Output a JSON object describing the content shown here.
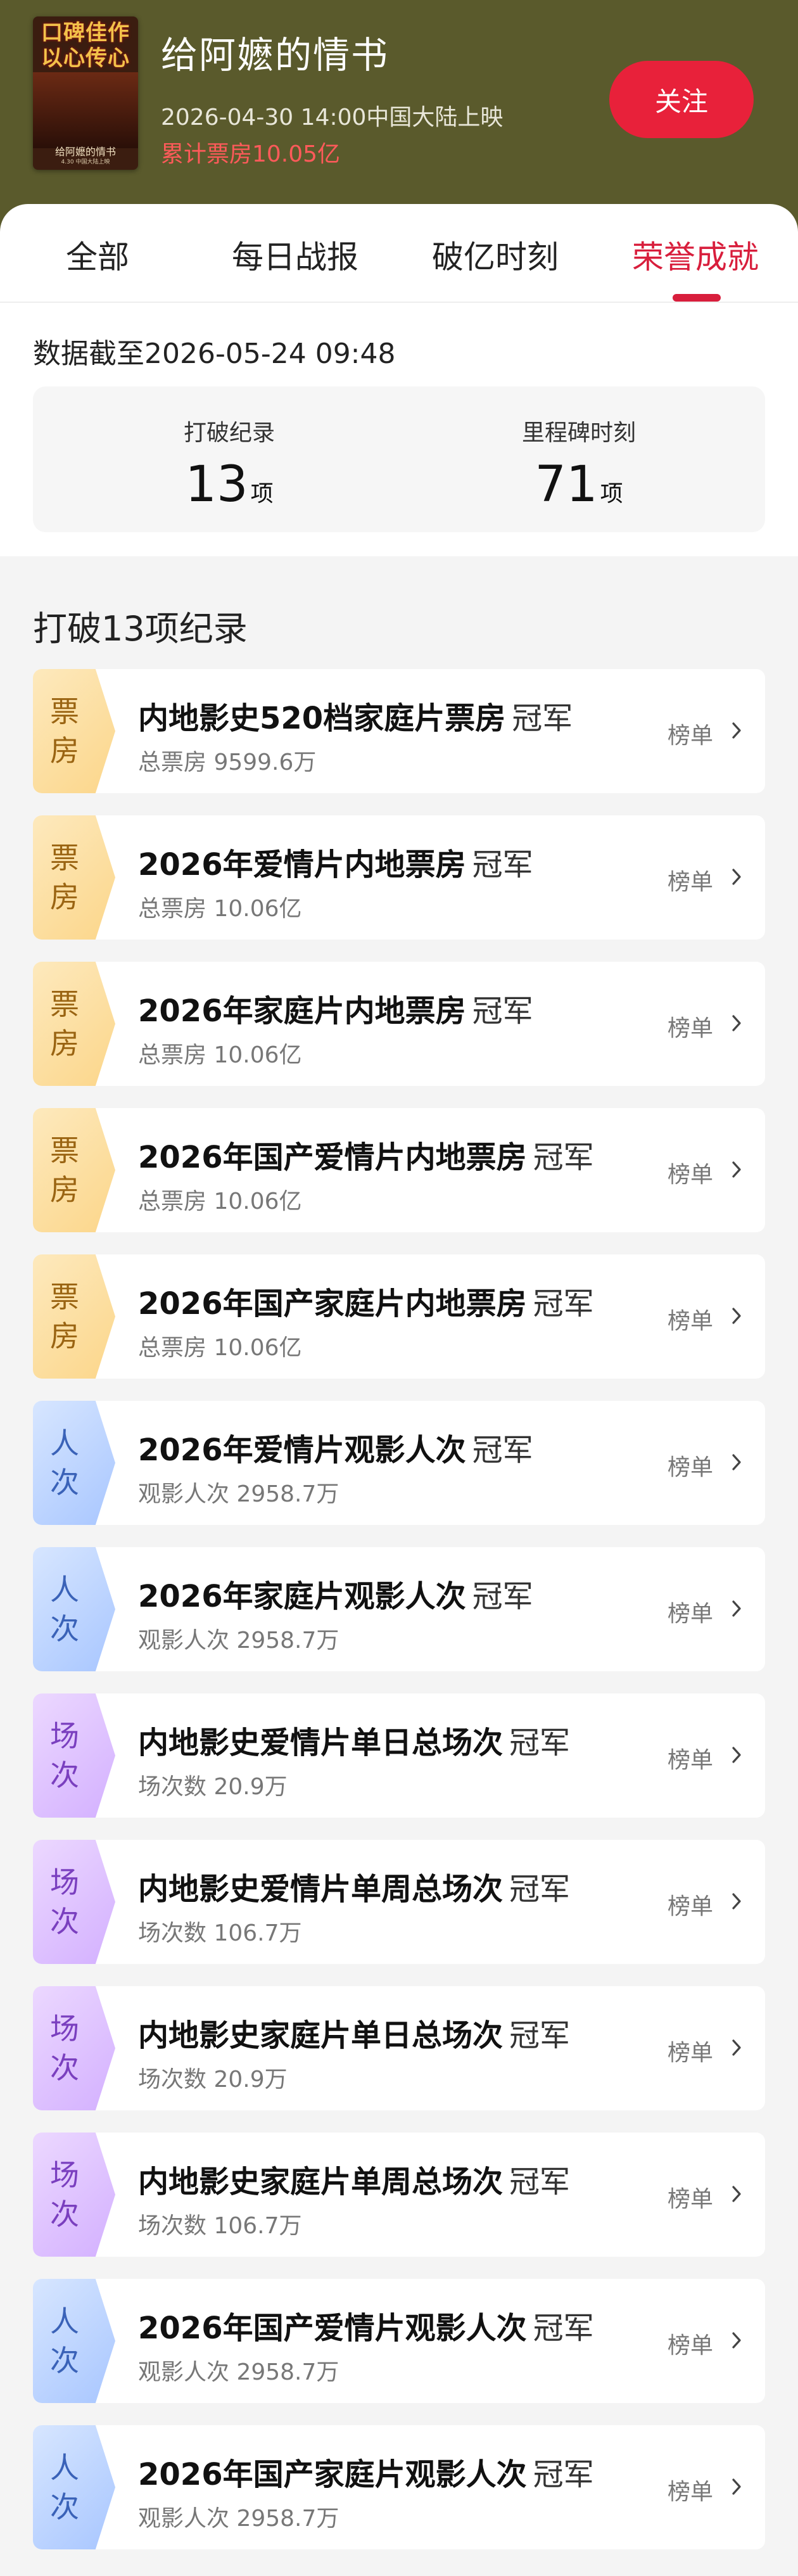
{
  "movie": {
    "poster_text": [
      "口碑佳作",
      "以心传心"
    ],
    "poster_film": "给阿嬷的情书",
    "poster_footer": "4.30 中国大陆上映",
    "title": "给阿嬷的情书",
    "release": "2026-04-30 14:00中国大陆上映",
    "box_office": "累计票房10.05亿",
    "follow_label": "关注"
  },
  "tabs": [
    {
      "label": "全部"
    },
    {
      "label": "每日战报"
    },
    {
      "label": "破亿时刻"
    },
    {
      "label": "荣誉成就"
    }
  ],
  "active_tab": "荣誉成就",
  "stats": {
    "as_of_prefix": "数据截至",
    "as_of_time": "2026-05-24  09:48",
    "records_label": "打破纪录",
    "records_value": "13",
    "records_unit": "项",
    "milestones_label": "里程碑时刻",
    "milestones_value": "71",
    "milestones_unit": "项"
  },
  "section_title": "打破13项纪录",
  "records": [
    {
      "badge": [
        "票",
        "房"
      ],
      "kind": "box",
      "title": "内地影史520档家庭片票房",
      "champ": "冠军",
      "sub": "总票房 9599.6万",
      "link": "榜单"
    },
    {
      "badge": [
        "票",
        "房"
      ],
      "kind": "box",
      "title": "2026年爱情片内地票房",
      "champ": "冠军",
      "sub": "总票房 10.06亿",
      "link": "榜单"
    },
    {
      "badge": [
        "票",
        "房"
      ],
      "kind": "box",
      "title": "2026年家庭片内地票房",
      "champ": "冠军",
      "sub": "总票房 10.06亿",
      "link": "榜单"
    },
    {
      "badge": [
        "票",
        "房"
      ],
      "kind": "box",
      "title": "2026年国产爱情片内地票房",
      "champ": "冠军",
      "sub": "总票房 10.06亿",
      "link": "榜单"
    },
    {
      "badge": [
        "票",
        "房"
      ],
      "kind": "box",
      "title": "2026年国产家庭片内地票房",
      "champ": "冠军",
      "sub": "总票房 10.06亿",
      "link": "榜单"
    },
    {
      "badge": [
        "人",
        "次"
      ],
      "kind": "people",
      "title": "2026年爱情片观影人次",
      "champ": "冠军",
      "sub": "观影人次 2958.7万",
      "link": "榜单"
    },
    {
      "badge": [
        "人",
        "次"
      ],
      "kind": "people",
      "title": "2026年家庭片观影人次",
      "champ": "冠军",
      "sub": "观影人次 2958.7万",
      "link": "榜单"
    },
    {
      "badge": [
        "场",
        "次"
      ],
      "kind": "screen",
      "title": "内地影史爱情片单日总场次",
      "champ": "冠军",
      "sub": "场次数 20.9万",
      "link": "榜单"
    },
    {
      "badge": [
        "场",
        "次"
      ],
      "kind": "screen",
      "title": "内地影史爱情片单周总场次",
      "champ": "冠军",
      "sub": "场次数 106.7万",
      "link": "榜单"
    },
    {
      "badge": [
        "场",
        "次"
      ],
      "kind": "screen",
      "title": "内地影史家庭片单日总场次",
      "champ": "冠军",
      "sub": "场次数 20.9万",
      "link": "榜单"
    },
    {
      "badge": [
        "场",
        "次"
      ],
      "kind": "screen",
      "title": "内地影史家庭片单周总场次",
      "champ": "冠军",
      "sub": "场次数 106.7万",
      "link": "榜单"
    },
    {
      "badge": [
        "人",
        "次"
      ],
      "kind": "people",
      "title": "2026年国产爱情片观影人次",
      "champ": "冠军",
      "sub": "观影人次 2958.7万",
      "link": "榜单"
    },
    {
      "badge": [
        "人",
        "次"
      ],
      "kind": "people",
      "title": "2026年国产家庭片观影人次",
      "champ": "冠军",
      "sub": "观影人次 2958.7万",
      "link": "榜单"
    }
  ]
}
